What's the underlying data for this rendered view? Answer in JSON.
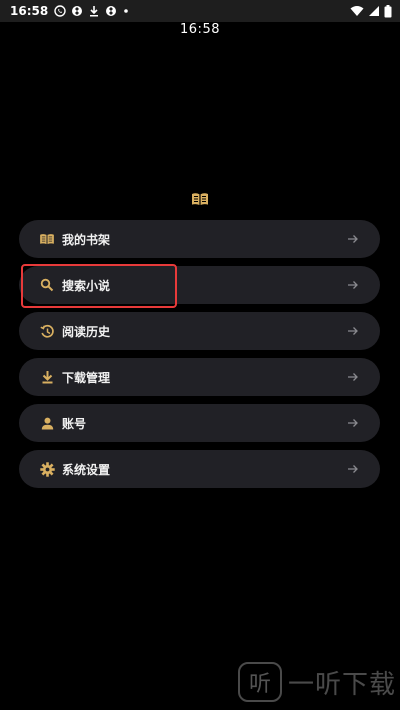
{
  "status_bar": {
    "time": "16:58",
    "left_icons": [
      "whatsapp-icon",
      "sync-icon",
      "download-icon",
      "sync-icon",
      "dot-icon"
    ],
    "right_icons": [
      "wifi-icon",
      "signal-icon",
      "battery-icon"
    ]
  },
  "header": {
    "clock": "16:58",
    "logo_icon": "book-icon"
  },
  "menu": {
    "items": [
      {
        "label": "我的书架",
        "icon": "book-icon"
      },
      {
        "label": "搜索小说",
        "icon": "search-icon"
      },
      {
        "label": "阅读历史",
        "icon": "history-icon"
      },
      {
        "label": "下载管理",
        "icon": "download-icon"
      },
      {
        "label": "账号",
        "icon": "person-icon"
      },
      {
        "label": "系统设置",
        "icon": "gear-icon"
      }
    ]
  },
  "highlight": {
    "target": "搜索小说",
    "color": "#e83a3a"
  },
  "colors": {
    "accent": "#d9b061",
    "item_bg": "#212126",
    "background": "#000000"
  },
  "watermark": {
    "icon_glyph": "听",
    "text": "一听下载"
  }
}
